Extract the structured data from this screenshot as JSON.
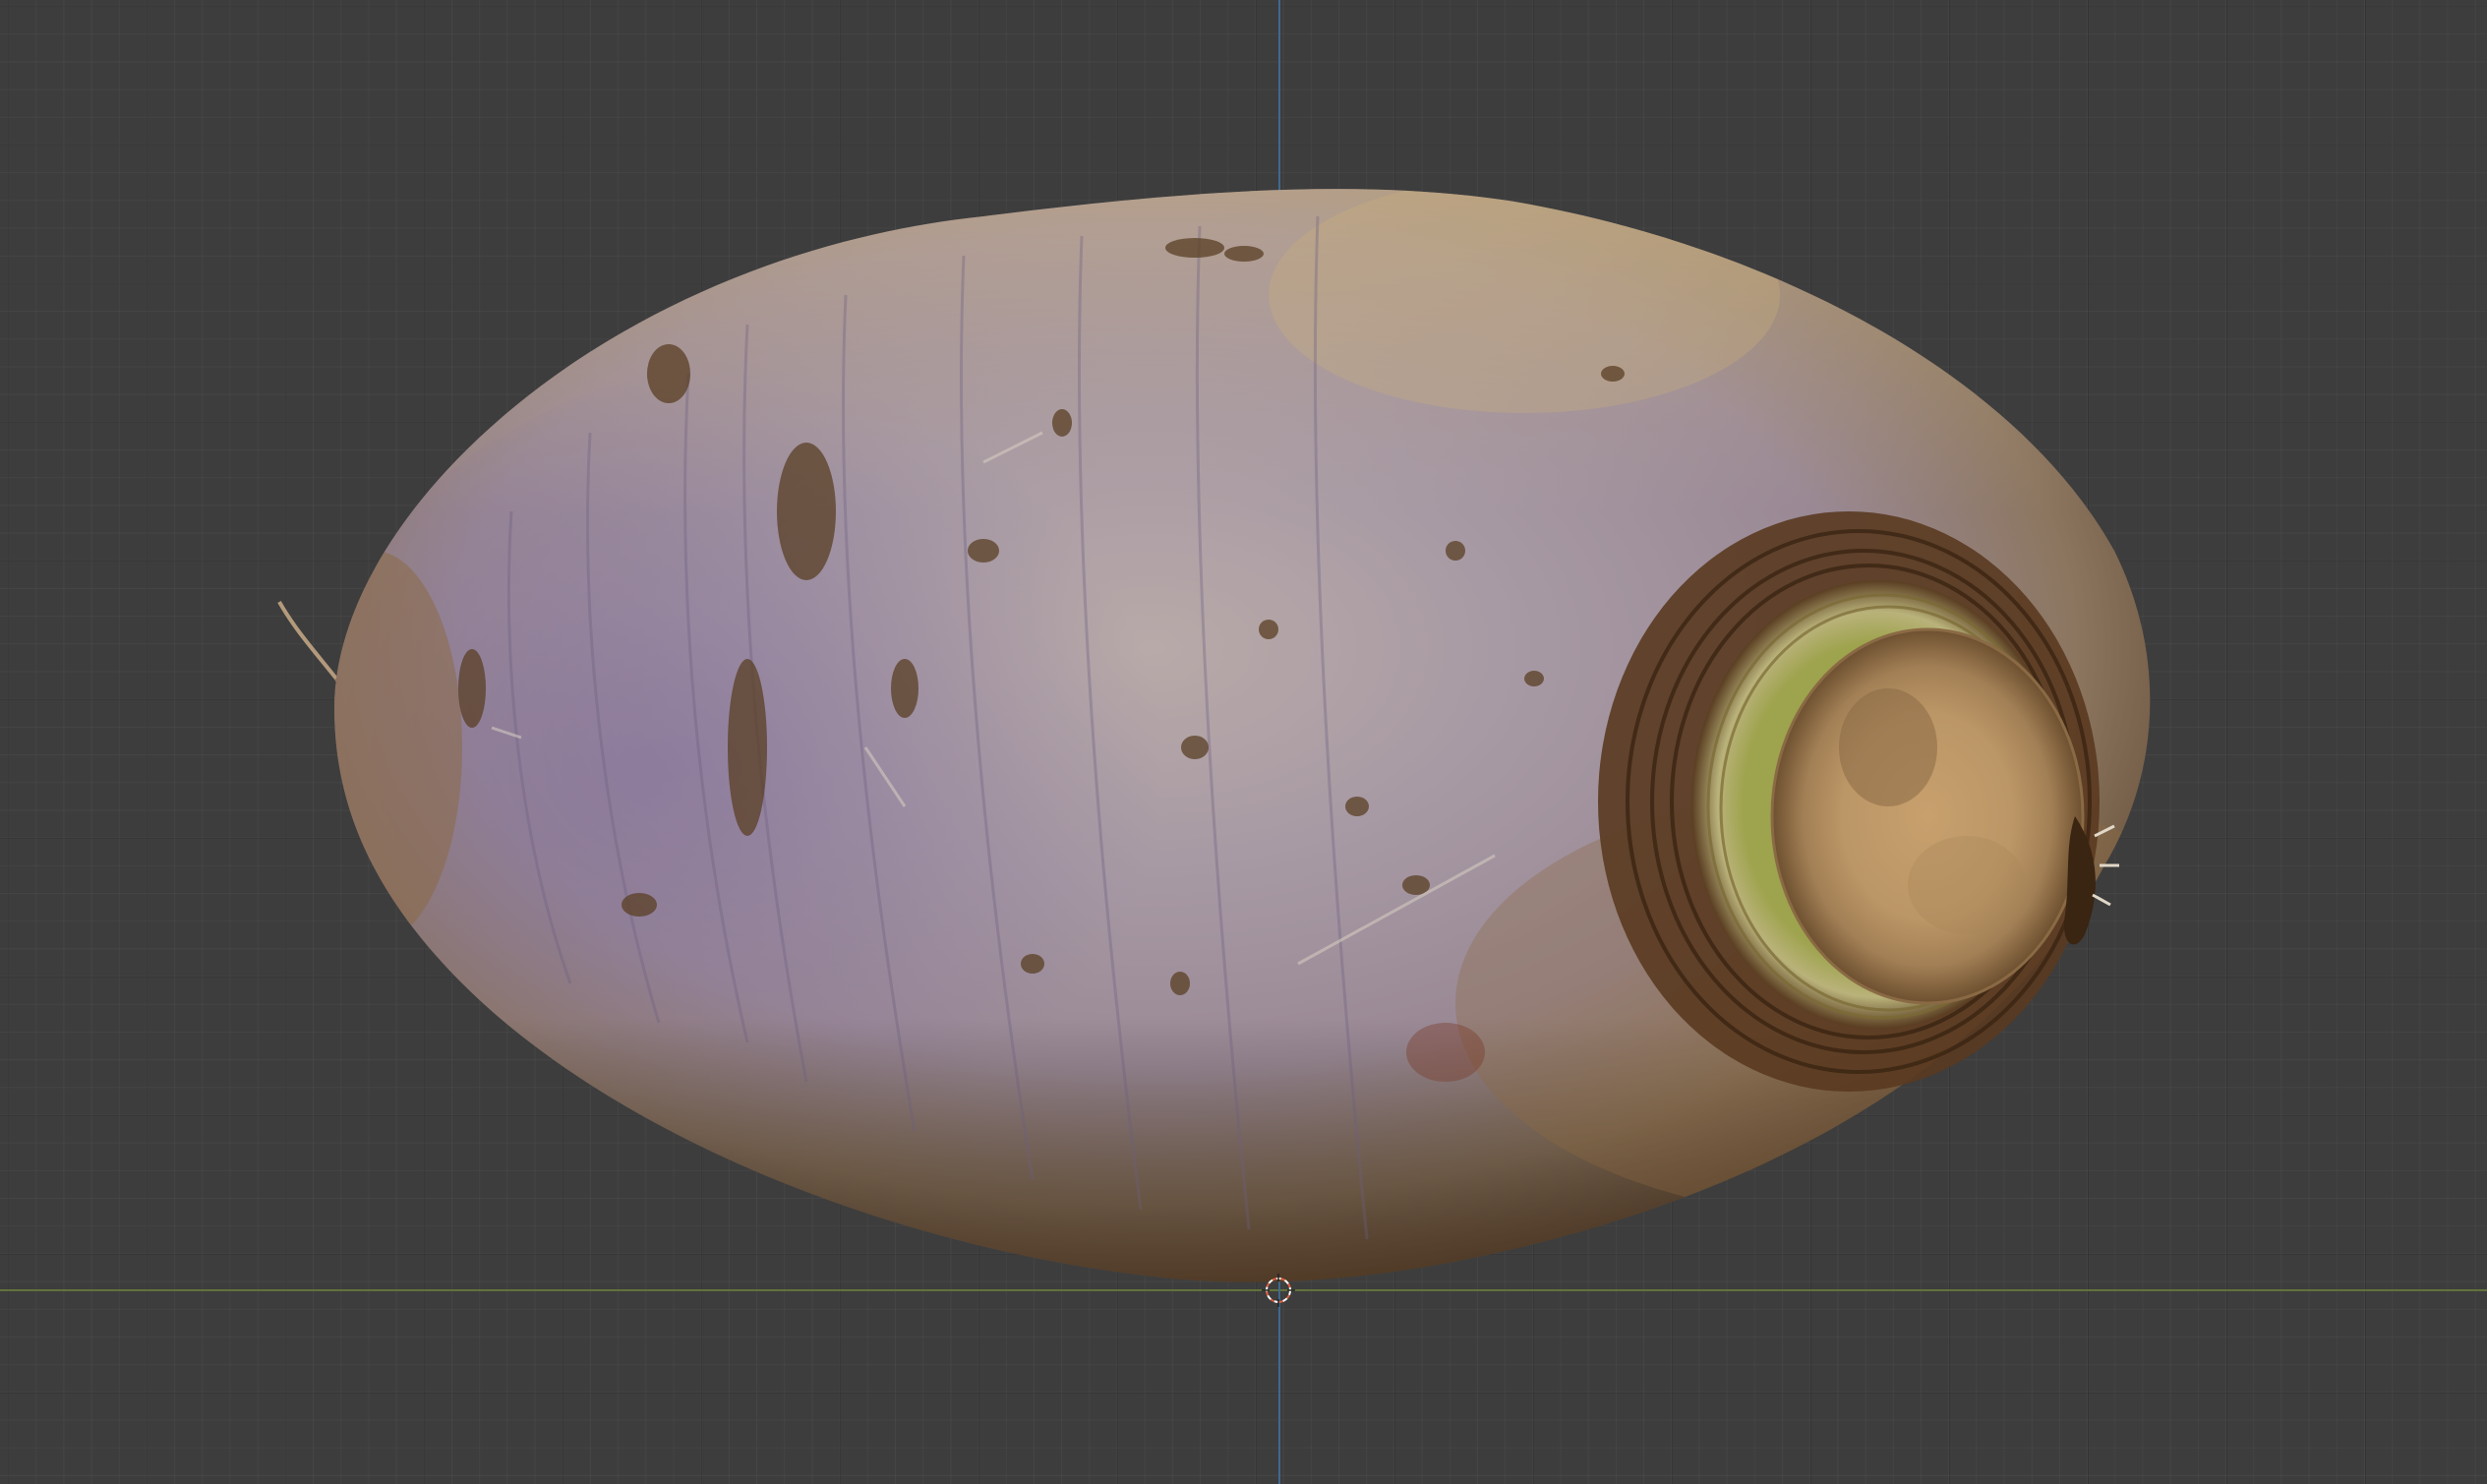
{
  "viewport": {
    "background_color": "#3d3d3d",
    "x_axis_color": "#6a7a3a",
    "z_axis_color": "#3e6e98"
  },
  "object": {
    "icon": "rutabaga-mesh",
    "skin_colors": [
      "#a99a94",
      "#8b7d9b",
      "#a8875c",
      "#6a4a2a"
    ],
    "crown_colors": [
      "#c7a67b",
      "#9aa24a",
      "#5a3a1f"
    ]
  },
  "cursor": {
    "icon": "3d-cursor-icon",
    "color_a": "#e06040",
    "color_b": "#ffffff"
  }
}
